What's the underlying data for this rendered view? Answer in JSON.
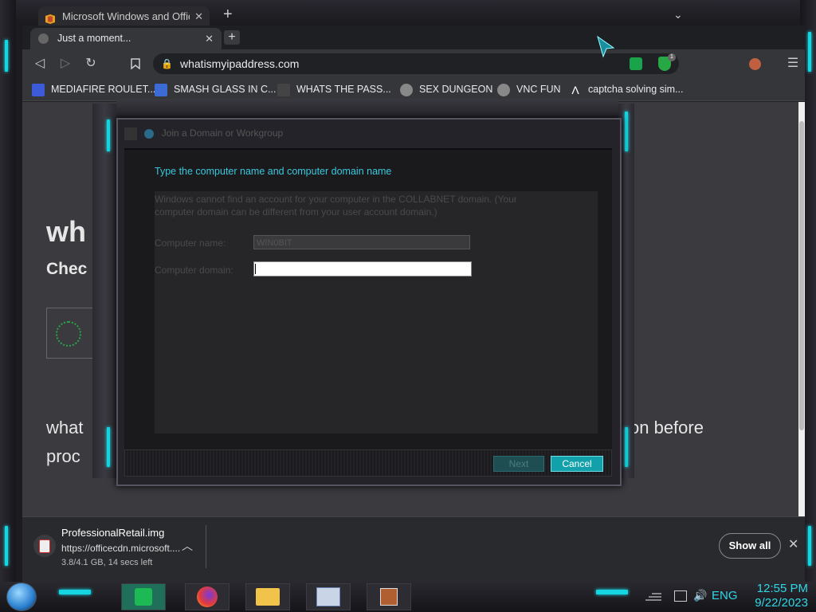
{
  "back_window": {
    "tab_title": "Microsoft Windows and Office",
    "new_tab_symbol": "+",
    "close_symbol": "✕"
  },
  "browser": {
    "tab_title": "Just a moment...",
    "tab_close": "✕",
    "new_tab": "+",
    "url": "whatismyipaddress.com",
    "extension_badge": "1",
    "bookmarks": [
      {
        "label": "MEDIAFIRE ROULET...",
        "icon_color": "#3b5bdb"
      },
      {
        "label": "SMASH GLASS IN C...",
        "icon_color": "#3d6bd6"
      },
      {
        "label": "WHATS THE PASS...",
        "icon_color": "#444444"
      },
      {
        "label": "SEX DUNGEON",
        "icon_color": "#888888"
      },
      {
        "label": "VNC FUN",
        "icon_color": "#888888"
      },
      {
        "label": "captcha solving sim...",
        "icon_color": "#35363a"
      }
    ]
  },
  "page": {
    "title_fragment": "wh",
    "subtitle_fragment": "Chec",
    "body_line1_start": "what",
    "body_line1_end": "on before",
    "body_line2_start": "proc"
  },
  "dialog": {
    "title": "Join a Domain or Workgroup",
    "heading": "Type the computer name and computer domain name",
    "message": "Windows cannot find an account for your computer in the COLLABNET domain. (Your computer domain can be different from your user account domain.)",
    "computer_name_label": "Computer name:",
    "computer_name_value": "WIN0BIT",
    "computer_domain_label": "Computer domain:",
    "computer_domain_value": "",
    "next_label": "Next",
    "cancel_label": "Cancel"
  },
  "download": {
    "filename": "ProfessionalRetail.img",
    "url": "https://officecdn.microsoft....",
    "status": "3.8/4.1 GB, 14 secs left",
    "show_all": "Show all",
    "close": "✕"
  },
  "taskbar": {
    "language": "ENG",
    "time": "12:55 PM",
    "date": "9/22/2023"
  },
  "colors": {
    "accent": "#16d4e0",
    "cancel_button": "#12a0aa",
    "dialog_heading": "#38c8dc"
  }
}
